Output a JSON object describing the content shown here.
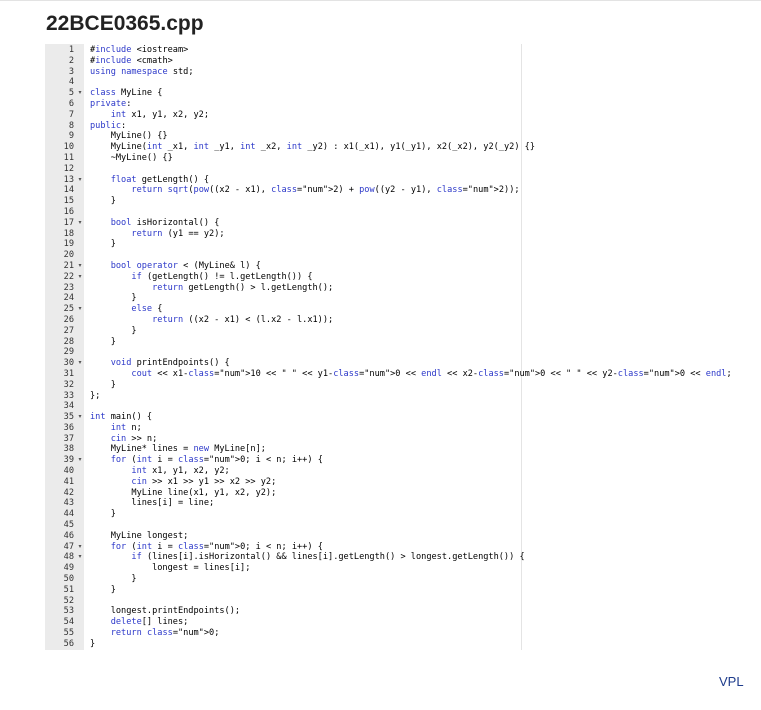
{
  "file": {
    "title": "22BCE0365.cpp"
  },
  "footer": {
    "link_label": "VPL"
  },
  "editor": {
    "fold_marker": "▾",
    "lines": [
      {
        "n": 1,
        "text": "#include <iostream>",
        "fold": false
      },
      {
        "n": 2,
        "text": "#include <cmath>",
        "fold": false
      },
      {
        "n": 3,
        "text": "using namespace std;",
        "fold": false
      },
      {
        "n": 4,
        "text": "",
        "fold": false
      },
      {
        "n": 5,
        "text": "class MyLine {",
        "fold": true
      },
      {
        "n": 6,
        "text": "private:",
        "fold": false
      },
      {
        "n": 7,
        "text": "    int x1, y1, x2, y2;",
        "fold": false
      },
      {
        "n": 8,
        "text": "public:",
        "fold": false
      },
      {
        "n": 9,
        "text": "    MyLine() {}",
        "fold": false
      },
      {
        "n": 10,
        "text": "    MyLine(int _x1, int _y1, int _x2, int _y2) : x1(_x1), y1(_y1), x2(_x2), y2(_y2) {}",
        "fold": false
      },
      {
        "n": 11,
        "text": "    ~MyLine() {}",
        "fold": false
      },
      {
        "n": 12,
        "text": "",
        "fold": false
      },
      {
        "n": 13,
        "text": "    float getLength() {",
        "fold": true
      },
      {
        "n": 14,
        "text": "        return sqrt(pow((x2 - x1), 2) + pow((y2 - y1), 2));",
        "fold": false
      },
      {
        "n": 15,
        "text": "    }",
        "fold": false
      },
      {
        "n": 16,
        "text": "",
        "fold": false
      },
      {
        "n": 17,
        "text": "    bool isHorizontal() {",
        "fold": true
      },
      {
        "n": 18,
        "text": "        return (y1 == y2);",
        "fold": false
      },
      {
        "n": 19,
        "text": "    }",
        "fold": false
      },
      {
        "n": 20,
        "text": "",
        "fold": false
      },
      {
        "n": 21,
        "text": "    bool operator < (MyLine& l) {",
        "fold": true
      },
      {
        "n": 22,
        "text": "        if (getLength() != l.getLength()) {",
        "fold": true
      },
      {
        "n": 23,
        "text": "            return getLength() > l.getLength();",
        "fold": false
      },
      {
        "n": 24,
        "text": "        }",
        "fold": false
      },
      {
        "n": 25,
        "text": "        else {",
        "fold": true
      },
      {
        "n": 26,
        "text": "            return ((x2 - x1) < (l.x2 - l.x1));",
        "fold": false
      },
      {
        "n": 27,
        "text": "        }",
        "fold": false
      },
      {
        "n": 28,
        "text": "    }",
        "fold": false
      },
      {
        "n": 29,
        "text": "",
        "fold": false
      },
      {
        "n": 30,
        "text": "    void printEndpoints() {",
        "fold": true
      },
      {
        "n": 31,
        "text": "        cout << x1-10 << \" \" << y1-0 << endl << x2-0 << \" \" << y2-0 << endl;",
        "fold": false
      },
      {
        "n": 32,
        "text": "    }",
        "fold": false
      },
      {
        "n": 33,
        "text": "};",
        "fold": false
      },
      {
        "n": 34,
        "text": "",
        "fold": false
      },
      {
        "n": 35,
        "text": "int main() {",
        "fold": true
      },
      {
        "n": 36,
        "text": "    int n;",
        "fold": false
      },
      {
        "n": 37,
        "text": "    cin >> n;",
        "fold": false
      },
      {
        "n": 38,
        "text": "    MyLine* lines = new MyLine[n];",
        "fold": false
      },
      {
        "n": 39,
        "text": "    for (int i = 0; i < n; i++) {",
        "fold": true
      },
      {
        "n": 40,
        "text": "        int x1, y1, x2, y2;",
        "fold": false
      },
      {
        "n": 41,
        "text": "        cin >> x1 >> y1 >> x2 >> y2;",
        "fold": false
      },
      {
        "n": 42,
        "text": "        MyLine line(x1, y1, x2, y2);",
        "fold": false
      },
      {
        "n": 43,
        "text": "        lines[i] = line;",
        "fold": false
      },
      {
        "n": 44,
        "text": "    }",
        "fold": false
      },
      {
        "n": 45,
        "text": "",
        "fold": false
      },
      {
        "n": 46,
        "text": "    MyLine longest;",
        "fold": false
      },
      {
        "n": 47,
        "text": "    for (int i = 0; i < n; i++) {",
        "fold": true
      },
      {
        "n": 48,
        "text": "        if (lines[i].isHorizontal() && lines[i].getLength() > longest.getLength()) {",
        "fold": true
      },
      {
        "n": 49,
        "text": "            longest = lines[i];",
        "fold": false
      },
      {
        "n": 50,
        "text": "        }",
        "fold": false
      },
      {
        "n": 51,
        "text": "    }",
        "fold": false
      },
      {
        "n": 52,
        "text": "",
        "fold": false
      },
      {
        "n": 53,
        "text": "    longest.printEndpoints();",
        "fold": false
      },
      {
        "n": 54,
        "text": "    delete[] lines;",
        "fold": false
      },
      {
        "n": 55,
        "text": "    return 0;",
        "fold": false
      },
      {
        "n": 56,
        "text": "}",
        "fold": false
      }
    ]
  }
}
